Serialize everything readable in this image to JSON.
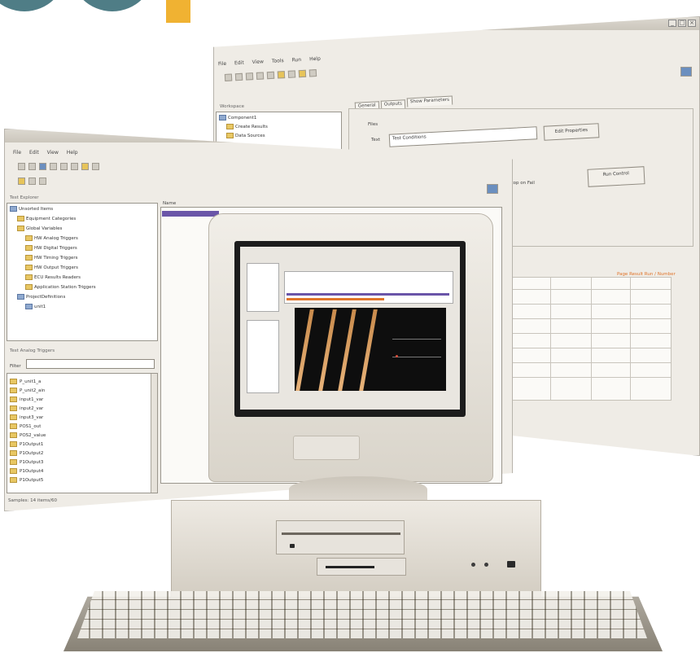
{
  "colors": {
    "logo_teal": "#4f7d86",
    "logo_orange": "#f0b232",
    "selection": "#6a55a8",
    "chart_background": "#0e0e0e",
    "chart_stripe": "#d9a066",
    "accent_orange_text": "#e0742a"
  },
  "back_window": {
    "menu": [
      "File",
      "Edit",
      "View",
      "Tools",
      "Run",
      "Help"
    ],
    "panel_title": "Workspace",
    "tree_items": [
      "Component1",
      "Create Results",
      "Data Sources"
    ],
    "tabs": [
      "General",
      "Outputs",
      "Show Parameters"
    ],
    "group_label": "Files",
    "field_label": "Text",
    "field_value": "Test Conditions",
    "edit_button": "Edit Properties",
    "checkbox_label": "Stop on Fail",
    "run_button": "Run Control",
    "orange_caption": "Page Result Run / Number"
  },
  "front_window": {
    "menu": [
      "File",
      "Edit",
      "View",
      "Help"
    ],
    "tree_panel_title": "Test Explorer",
    "tree_items": [
      "Unsorted Items",
      "Equipment Categories",
      "Global Variables",
      "HW Analog Triggers",
      "HW Digital Triggers",
      "HW Timing Triggers",
      "HW Output Triggers",
      "ECU Results Readers",
      "Application Station Triggers",
      "ProjectDefinitions",
      "unit1"
    ],
    "list_panel_title": "Test Analog Triggers",
    "filter_label": "Filter",
    "list_items": [
      "P_unit1_a",
      "P_unit2_ain",
      "input1_var",
      "input2_var",
      "input3_var",
      "POS1_out",
      "POS2_value",
      "P1Output1",
      "P1Output2",
      "P1Output3",
      "P1Output4",
      "P1Output5"
    ],
    "grid_header": "Name",
    "status_text": "Samples: 14 items/60"
  },
  "monitor_screen": {
    "chart_type": "waveform"
  }
}
